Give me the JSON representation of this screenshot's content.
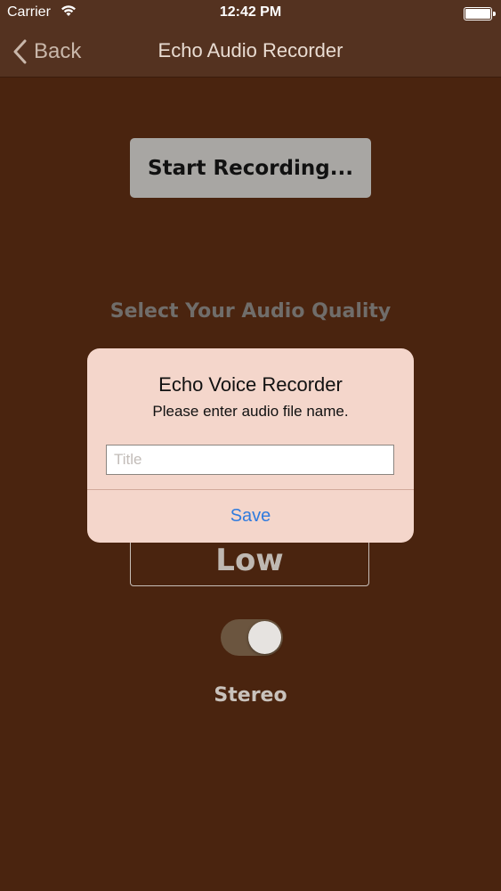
{
  "status_bar": {
    "carrier": "Carrier",
    "time": "12:42 PM",
    "icons": [
      "wifi-icon",
      "battery-icon"
    ]
  },
  "nav": {
    "back_label": "Back",
    "title": "Echo Audio Recorder"
  },
  "main": {
    "start_button_label": "Start Recording...",
    "quality_label": "Select Your Audio Quality",
    "quality_value": "Low",
    "stereo_toggle_on": true,
    "stereo_label": "Stereo"
  },
  "alert": {
    "title": "Echo Voice Recorder",
    "message": "Please enter audio file name.",
    "input_value": "",
    "input_placeholder": "Title",
    "save_label": "Save"
  },
  "colors": {
    "background": "#4a240f",
    "nav_background": "#543220",
    "alert_background": "#f4d6cb",
    "accent_blue": "#2f7bde"
  }
}
